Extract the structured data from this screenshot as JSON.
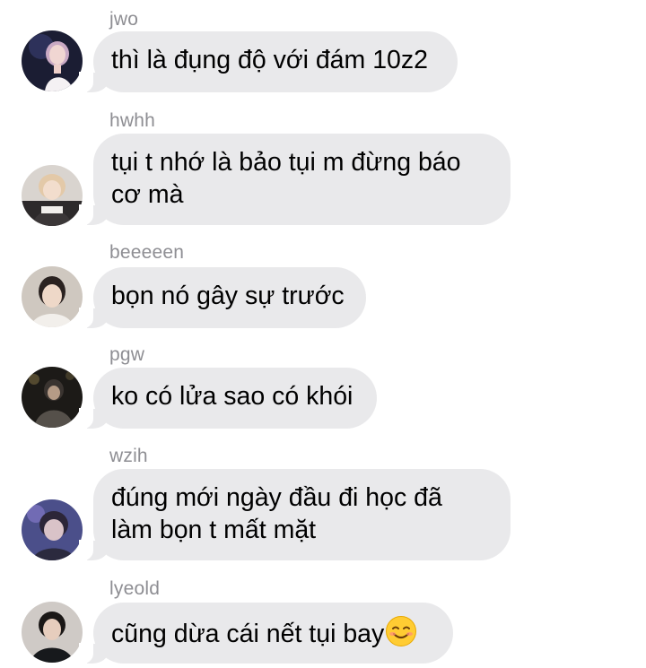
{
  "messages": [
    {
      "sender": "jwo",
      "lines": [
        "thì là đụng độ với đám  10z2"
      ],
      "avatar": "avatar-jwo"
    },
    {
      "sender": "hwhh",
      "lines": [
        "tụi t nhớ là bảo tụi m đừng báo",
        "cơ mà"
      ],
      "avatar": "avatar-hwhh"
    },
    {
      "sender": "beeeeen",
      "lines": [
        "bọn nó gây sự trước"
      ],
      "avatar": "avatar-beeeeen"
    },
    {
      "sender": "pgw",
      "lines": [
        "ko có lửa sao có khói"
      ],
      "avatar": "avatar-pgw"
    },
    {
      "sender": "wzih",
      "lines": [
        "đúng mới ngày đầu đi học đã",
        "làm bọn t mất mặt"
      ],
      "avatar": "avatar-wzih"
    },
    {
      "sender": "lyeold",
      "lines": [
        "cũng dừa cái nết tụi bay"
      ],
      "emoji": "smiling-face-icon",
      "avatar": "avatar-lyeold"
    }
  ],
  "colors": {
    "bubble": "#e9e9eb",
    "sender_name": "#8e8e93",
    "text": "#000000",
    "background": "#ffffff"
  }
}
